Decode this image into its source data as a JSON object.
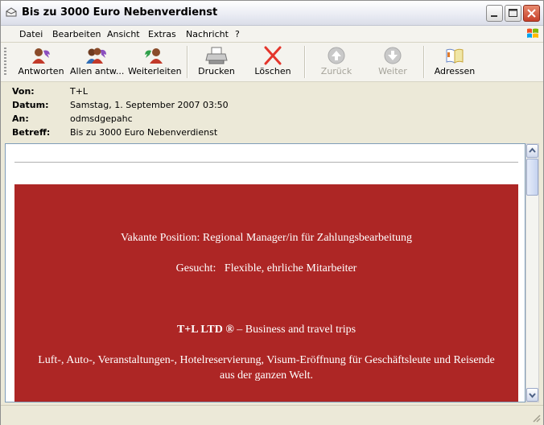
{
  "window": {
    "title": "Bis zu 3000 Euro Nebenverdienst"
  },
  "menu": {
    "items": [
      "Datei",
      "Bearbeiten",
      "Ansicht",
      "Extras",
      "Nachricht",
      "?"
    ]
  },
  "toolbar": {
    "reply": "Antworten",
    "reply_all": "Allen antw...",
    "forward": "Weiterleiten",
    "print": "Drucken",
    "delete": "Löschen",
    "back": "Zurück",
    "next": "Weiter",
    "addresses": "Adressen"
  },
  "header": {
    "from_label": "Von:",
    "from": "T+L",
    "date_label": "Datum:",
    "date": "Samstag, 1. September 2007 03:50",
    "to_label": "An:",
    "to": "odmsdgepahc",
    "subject_label": "Betreff:",
    "subject": "Bis zu 3000 Euro Nebenverdienst"
  },
  "body": {
    "line1": "Vakante Position: Regional Manager/in für Zahlungsbearbeitung",
    "line2": "Gesucht:   Flexible, ehrliche Mitarbeiter",
    "company": "T+L LTD ®",
    "line3_rest": " – Business and travel trips",
    "line4a": "Luft-, Auto-, Veranstaltungen-, Hotelreservierung, Visum-Eröffnung für Geschäftsleute und Reisende",
    "line4b": "aus der ganzen Welt."
  },
  "colors": {
    "banner": "#ad2625",
    "title_bg": "#e9ebf3"
  }
}
